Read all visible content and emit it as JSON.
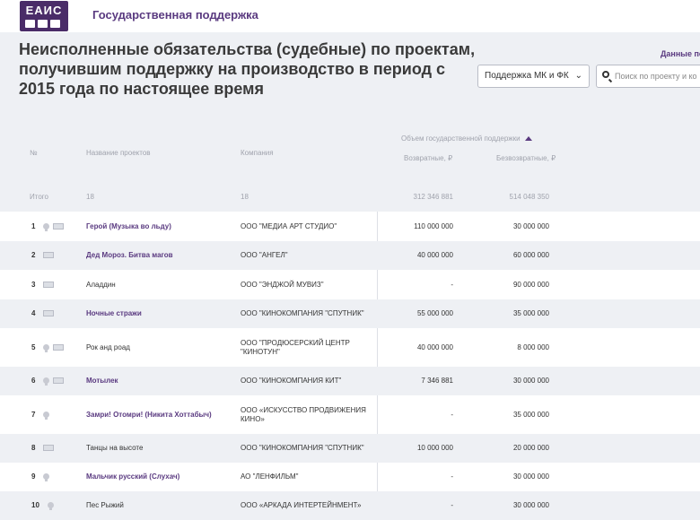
{
  "header": {
    "logo_text": "ЕАИС",
    "brand_title": "Государственная поддержка"
  },
  "hero": {
    "title": "Неисполненные обязательства (судебные) по проектам, получившим поддержку на производство в период с 2015 года по настоящее время",
    "data_link": "Данные по",
    "support_select_value": "Поддержка МК и ФК",
    "search_placeholder": "Поиск по проекту и ко"
  },
  "table": {
    "headers": {
      "num": "№",
      "name": "Название проектов",
      "company": "Компания",
      "volume": "Объем государственной поддержки",
      "returnable": "Возвратные, ₽",
      "nonreturnable": "Безвозвратные, ₽"
    },
    "total": {
      "label": "Итого",
      "projects": "18",
      "companies": "18",
      "returnable": "312 346 881",
      "nonreturnable": "514 048 350"
    },
    "rows": [
      {
        "num": "1",
        "award": true,
        "film": true,
        "name": "Герой (Музыка во льду)",
        "link": true,
        "company": "ООО \"МЕДИА АРТ СТУДИО\"",
        "returnable": "110 000 000",
        "nonreturnable": "30 000 000"
      },
      {
        "num": "2",
        "award": false,
        "film": true,
        "name": "Дед Мороз. Битва магов",
        "link": true,
        "company": "ООО \"АНГЕЛ\"",
        "returnable": "40 000 000",
        "nonreturnable": "60 000 000"
      },
      {
        "num": "3",
        "award": false,
        "film": true,
        "name": "Аладдин",
        "link": false,
        "company": "ООО \"ЭНДЖОЙ МУВИЗ\"",
        "returnable": "-",
        "nonreturnable": "90 000 000"
      },
      {
        "num": "4",
        "award": false,
        "film": true,
        "name": "Ночные стражи",
        "link": true,
        "company": "ООО \"КИНОКОМПАНИЯ \"СПУТНИК\"",
        "returnable": "55 000 000",
        "nonreturnable": "35 000 000"
      },
      {
        "num": "5",
        "award": true,
        "film": true,
        "name": "Рок анд роад",
        "link": false,
        "company": "ООО \"ПРОДЮСЕРСКИЙ ЦЕНТР \"КИНОТУН\"",
        "returnable": "40 000 000",
        "nonreturnable": "8 000 000"
      },
      {
        "num": "6",
        "award": true,
        "film": true,
        "name": "Мотылек",
        "link": true,
        "company": "ООО \"КИНОКОМПАНИЯ КИТ\"",
        "returnable": "7 346 881",
        "nonreturnable": "30 000 000"
      },
      {
        "num": "7",
        "award": true,
        "film": false,
        "name": "Замри! Отомри! (Никита Хоттабыч)",
        "link": true,
        "company": "ООО «ИСКУССТВО ПРОДВИЖЕНИЯ КИНО»",
        "returnable": "-",
        "nonreturnable": "35 000 000"
      },
      {
        "num": "8",
        "award": false,
        "film": true,
        "name": "Танцы на высоте",
        "link": false,
        "company": "ООО \"КИНОКОМПАНИЯ \"СПУТНИК\"",
        "returnable": "10 000 000",
        "nonreturnable": "20 000 000"
      },
      {
        "num": "9",
        "award": true,
        "film": false,
        "name": "Мальчик русский (Слухач)",
        "link": true,
        "company": "АО \"ЛЕНФИЛЬМ\"",
        "returnable": "-",
        "nonreturnable": "30 000 000"
      },
      {
        "num": "10",
        "award": true,
        "film": false,
        "name": "Пес Рыжий",
        "link": false,
        "company": "ООО «АРКАДА ИНТЕРТЕЙНМЕНТ»",
        "returnable": "-",
        "nonreturnable": "30 000 000"
      }
    ]
  },
  "colors": {
    "brand": "#5a3a80",
    "logo_bg": "#4a2c68",
    "stripe": "#eef0f4"
  }
}
